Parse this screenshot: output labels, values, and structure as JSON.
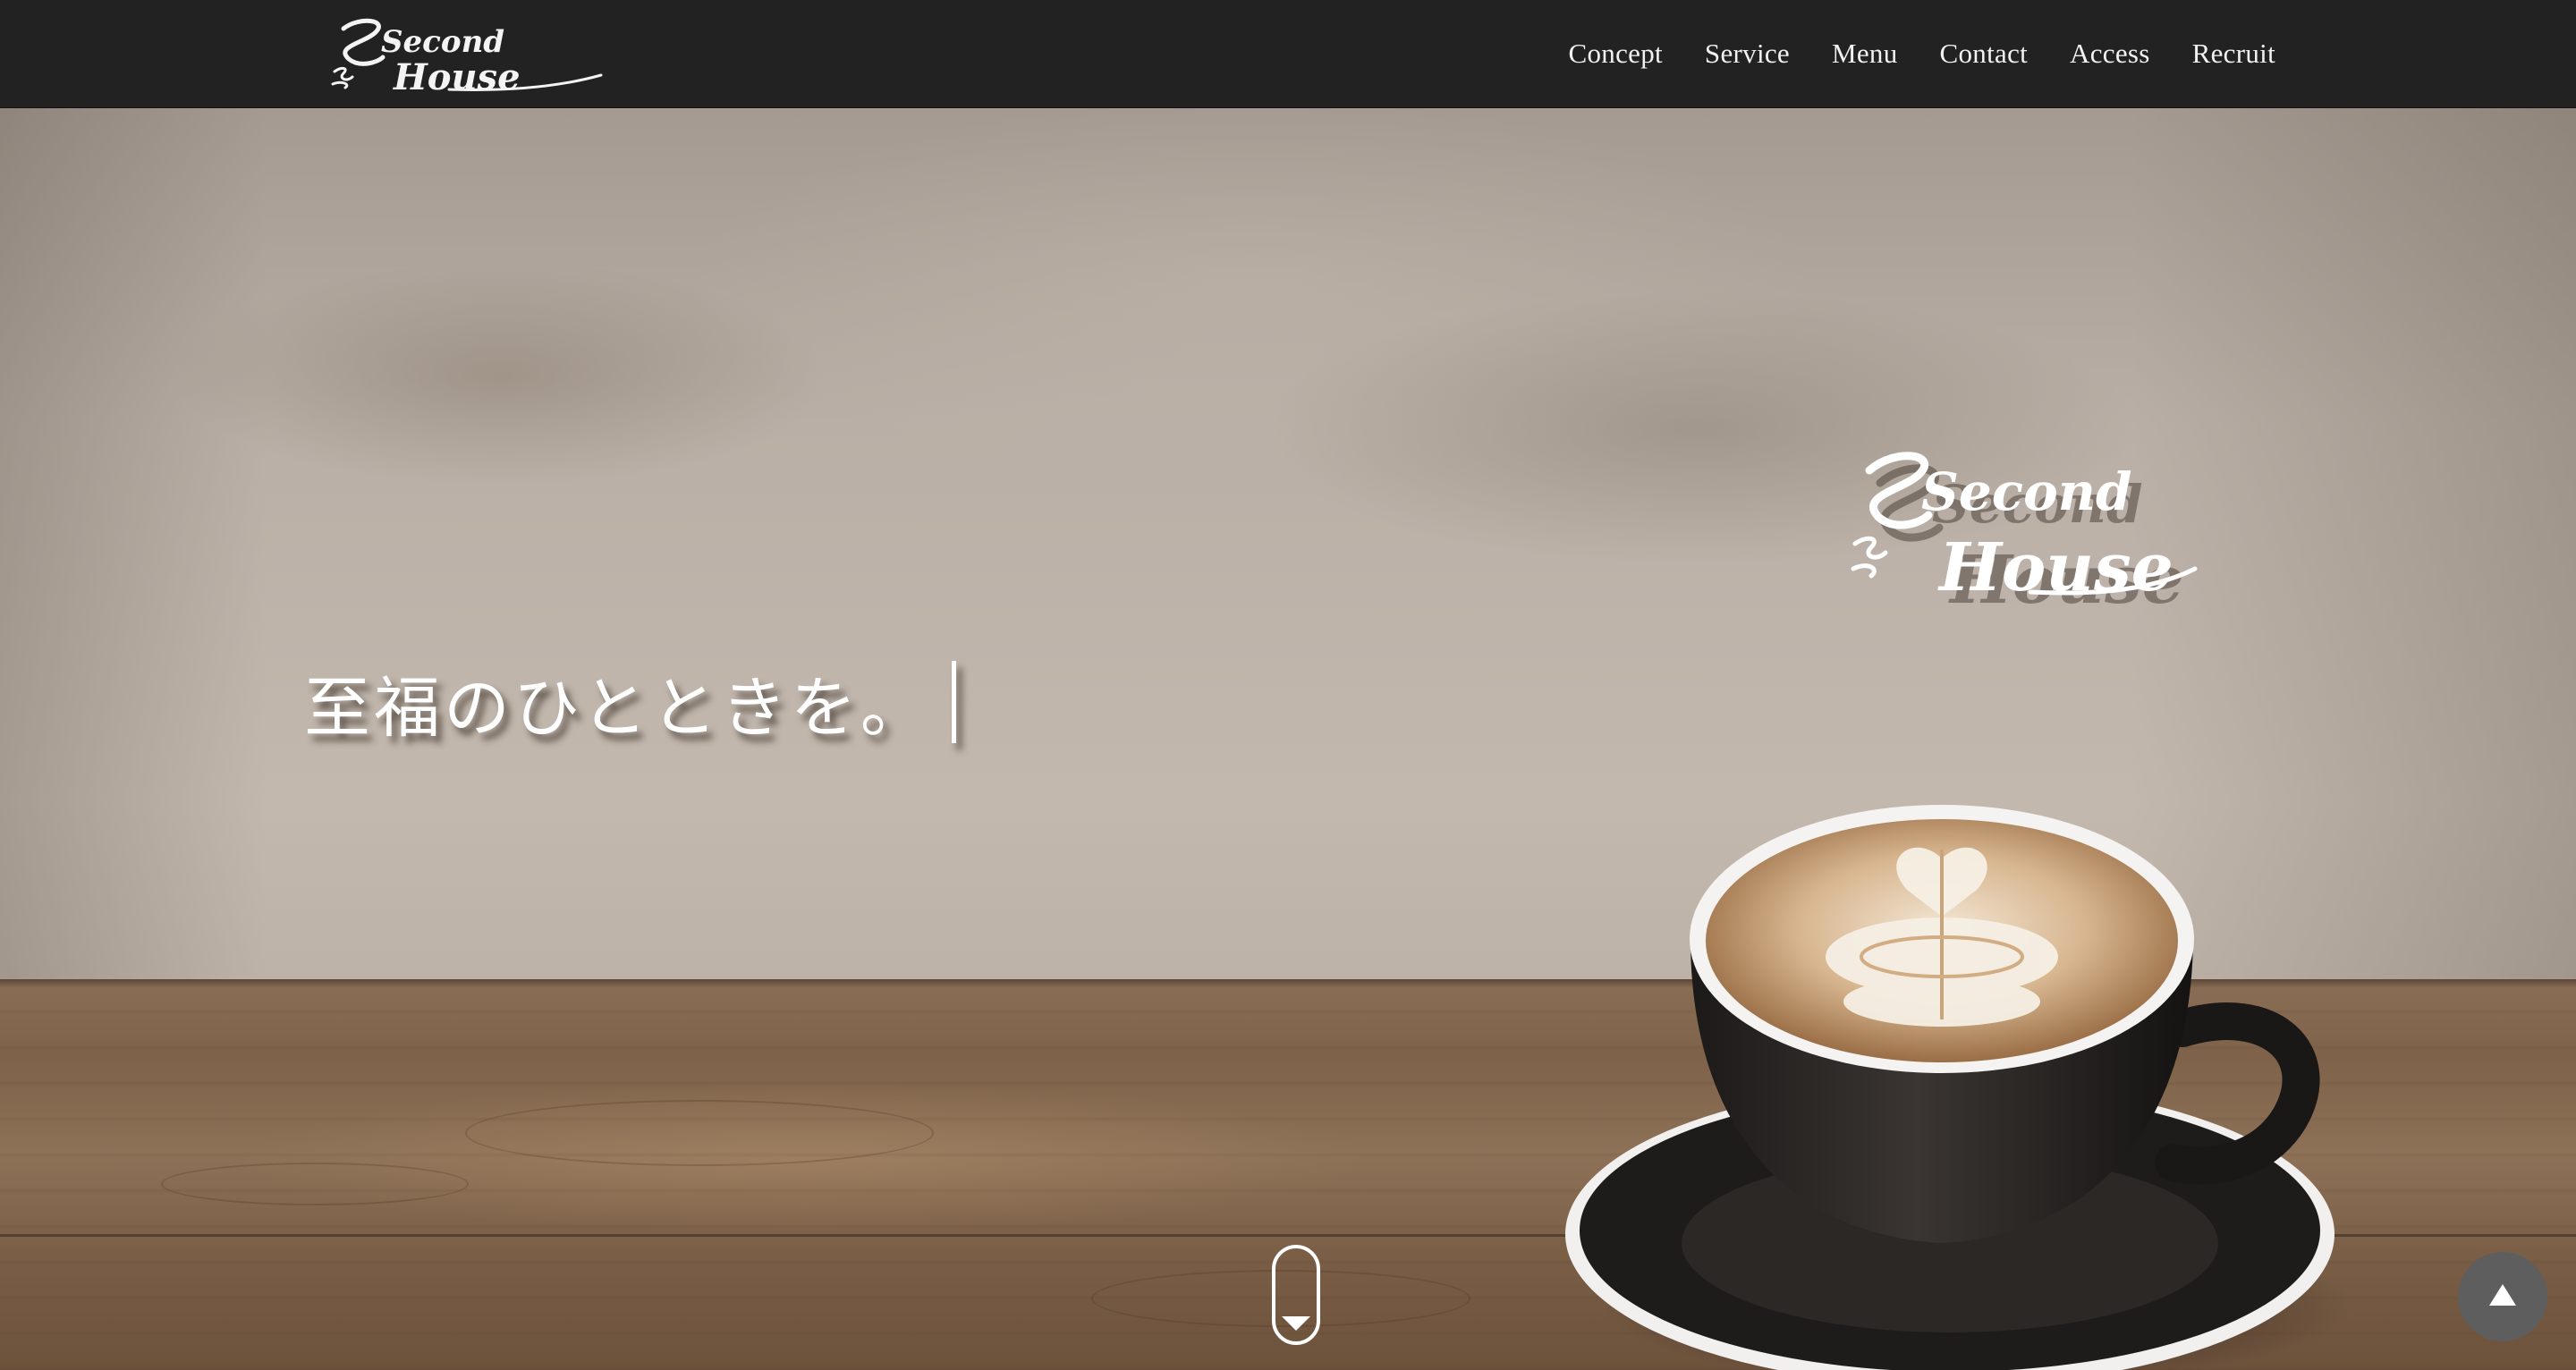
{
  "header": {
    "logo_text": [
      "Second",
      "House"
    ],
    "nav": [
      {
        "label": "Concept"
      },
      {
        "label": "Service"
      },
      {
        "label": "Menu"
      },
      {
        "label": "Contact"
      },
      {
        "label": "Access"
      },
      {
        "label": "Recruit"
      }
    ]
  },
  "hero": {
    "tagline": "至福のひとときを。",
    "logo_text": [
      "Second",
      "House"
    ]
  },
  "icons": {
    "scroll": "chevron-down-icon",
    "back_to_top": "arrow-up-icon"
  },
  "colors": {
    "header_bg": "#222222",
    "nav_text": "#f2f2f2",
    "back_to_top_bg": "#5e5e5e",
    "tagline": "#ffffff"
  }
}
